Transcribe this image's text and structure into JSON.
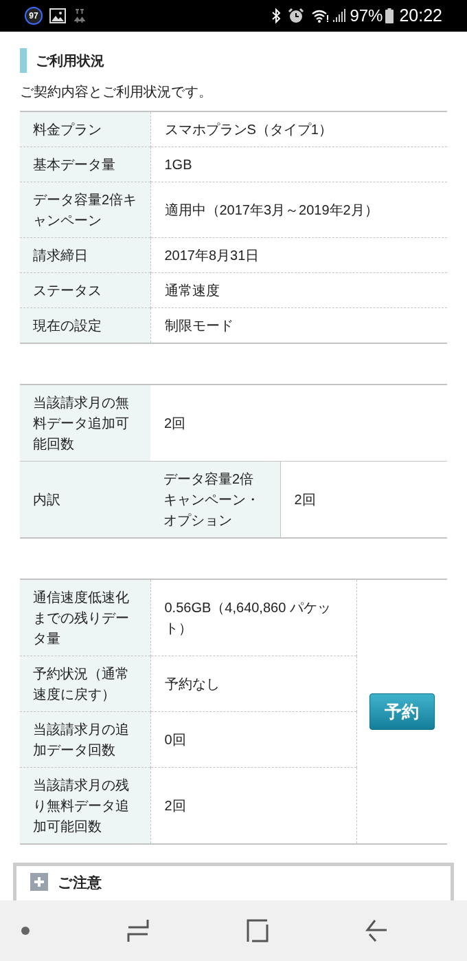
{
  "status_bar": {
    "notification_count": "97",
    "battery": "97%",
    "time": "20:22"
  },
  "section": {
    "title": "ご利用状況",
    "description": "ご契約内容とご利用状況です。"
  },
  "contract_table": [
    {
      "label": "料金プラン",
      "value": "スマホプランS（タイプ1）"
    },
    {
      "label": "基本データ量",
      "value": "1GB"
    },
    {
      "label": "データ容量2倍キャンペーン",
      "value": "適用中（2017年3月～2019年2月）"
    },
    {
      "label": "請求締日",
      "value": "2017年8月31日"
    },
    {
      "label": "ステータス",
      "value": "通常速度"
    },
    {
      "label": "現在の設定",
      "value": "制限モード"
    }
  ],
  "free_data_table": {
    "label": "当該請求月の無料データ追加可能回数",
    "value": "2回",
    "breakdown": {
      "label": "内訳",
      "sublabel": "データ容量2倍キャンペーン・オプション",
      "value": "2回"
    }
  },
  "usage_table": {
    "rows": [
      {
        "label": "通信速度低速化までの残りデータ量",
        "value": "0.56GB（4,640,860 パケット）"
      },
      {
        "label": "予約状況（通常速度に戻す）",
        "value": "予約なし"
      },
      {
        "label": "当該請求月の追加データ回数",
        "value": "0回"
      },
      {
        "label": "当該請求月の残り無料データ追加可能回数",
        "value": "2回"
      }
    ],
    "reserve_button": "予約"
  },
  "notice": {
    "title": "ご注意"
  }
}
